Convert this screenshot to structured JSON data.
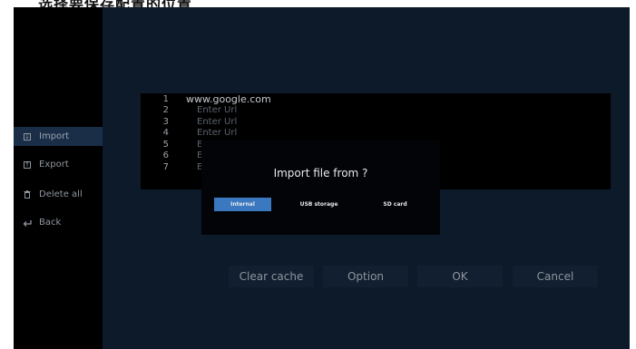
{
  "caption": "选择要保存配置的位置",
  "sidebar": {
    "items": [
      {
        "label": "Import",
        "icon": "import-icon"
      },
      {
        "label": "Export",
        "icon": "export-icon"
      },
      {
        "label": "Delete all",
        "icon": "trash-icon"
      },
      {
        "label": "Back",
        "icon": "back-icon"
      }
    ]
  },
  "url_list": [
    {
      "num": "1",
      "text": "www.google.com"
    },
    {
      "num": "2",
      "text": "Enter Url"
    },
    {
      "num": "3",
      "text": "Enter Url"
    },
    {
      "num": "4",
      "text": "Enter Url"
    },
    {
      "num": "5",
      "text": "E"
    },
    {
      "num": "6",
      "text": "E"
    },
    {
      "num": "7",
      "text": "E"
    }
  ],
  "dialog": {
    "title": "Import file from ?",
    "options": [
      "Internal",
      "USB storage",
      "SD card"
    ],
    "selected": "Internal"
  },
  "buttons": {
    "clear_cache": "Clear cache",
    "option": "Option",
    "ok": "OK",
    "cancel": "Cancel"
  },
  "colors": {
    "accent": "#3a78c0",
    "selected_item": "#1a2e47",
    "background": "#0d1a2a"
  }
}
